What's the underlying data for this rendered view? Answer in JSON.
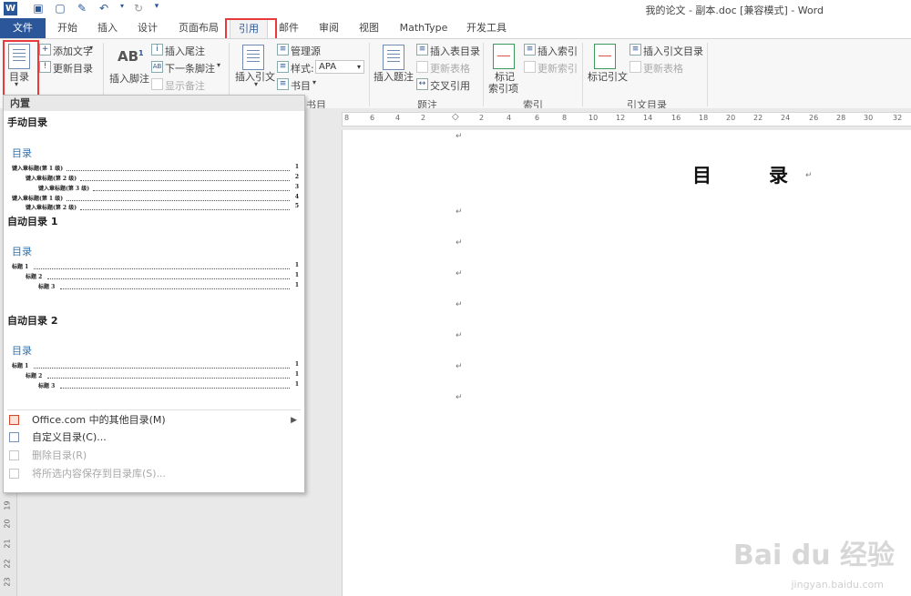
{
  "window": {
    "title": "我的论文 - 副本.doc [兼容模式] - Word",
    "app_logo": "W"
  },
  "quick_access": [
    "save-icon",
    "new-icon",
    "format-painter-icon",
    "undo-icon",
    "redo-icon",
    "customize-icon"
  ],
  "tabs": [
    {
      "label": "文件"
    },
    {
      "label": "开始"
    },
    {
      "label": "插入"
    },
    {
      "label": "设计"
    },
    {
      "label": "页面布局"
    },
    {
      "label": "引用"
    },
    {
      "label": "邮件"
    },
    {
      "label": "审阅"
    },
    {
      "label": "视图"
    },
    {
      "label": "MathType"
    },
    {
      "label": "开发工具"
    }
  ],
  "ribbon": {
    "toc": {
      "big_button": "目录",
      "add_text": "添加文字",
      "update_toc": "更新目录"
    },
    "footnotes": {
      "insert_footnote": "插入脚注",
      "insert_endnote": "插入尾注",
      "next_footnote": "下一条脚注",
      "show_notes": "显示备注",
      "ab_glyph": "AB",
      "ab_sup": "1"
    },
    "citations": {
      "insert_citation": "插入引文",
      "manage_sources": "管理源",
      "style_label": "样式:",
      "style_value": "APA",
      "bibliography": "书目",
      "group_label": "书目"
    },
    "captions": {
      "insert_caption": "插入题注",
      "insert_table_of_figures": "插入表目录",
      "update_table": "更新表格",
      "cross_reference": "交叉引用",
      "group_label": "题注"
    },
    "index": {
      "mark_entry_line1": "标记",
      "mark_entry_line2": "索引项",
      "insert_index": "插入索引",
      "update_index": "更新索引",
      "group_label": "索引"
    },
    "toa": {
      "mark_citation": "标记引文",
      "insert_toa": "插入引文目录",
      "update_table": "更新表格",
      "group_label": "引文目录"
    }
  },
  "dropdown": {
    "header": "内置",
    "manual": {
      "section": "手动目录",
      "toc_title": "目录",
      "lines": [
        {
          "text": "键入章标题(第 1 级)",
          "page": "1"
        },
        {
          "text": "键入章标题(第 2 级)",
          "page": "2"
        },
        {
          "text": "键入章标题(第 3 级)",
          "page": "3"
        },
        {
          "text": "键入章标题(第 1 级)",
          "page": "4"
        },
        {
          "text": "键入章标题(第 2 级)",
          "page": "5"
        }
      ]
    },
    "auto1": {
      "section": "自动目录 1",
      "toc_title": "目录",
      "lines": [
        {
          "text": "标题 1",
          "page": "1"
        },
        {
          "text": "标题 2",
          "page": "1"
        },
        {
          "text": "标题 3",
          "page": "1"
        }
      ]
    },
    "auto2": {
      "section": "自动目录 2",
      "toc_title": "目录",
      "lines": [
        {
          "text": "标题 1",
          "page": "1"
        },
        {
          "text": "标题 2",
          "page": "1"
        },
        {
          "text": "标题 3",
          "page": "1"
        }
      ]
    },
    "items": {
      "more_online": "Office.com 中的其他目录(M)",
      "custom_toc": "自定义目录(C)...",
      "remove_toc": "删除目录(R)",
      "save_selection": "将所选内容保存到目录库(S)..."
    }
  },
  "ruler": {
    "horizontal": [
      "8",
      "6",
      "4",
      "2",
      "2",
      "4",
      "6",
      "8",
      "10",
      "12",
      "14",
      "16",
      "18",
      "20",
      "22",
      "24",
      "26",
      "28",
      "30",
      "32"
    ],
    "vertical": [
      "19",
      "20",
      "21",
      "22",
      "23"
    ]
  },
  "document": {
    "heading": "目　　　录",
    "para_mark": "↵"
  },
  "watermark": {
    "main": "Bai du 经验",
    "sub": "jingyan.baidu.com"
  }
}
